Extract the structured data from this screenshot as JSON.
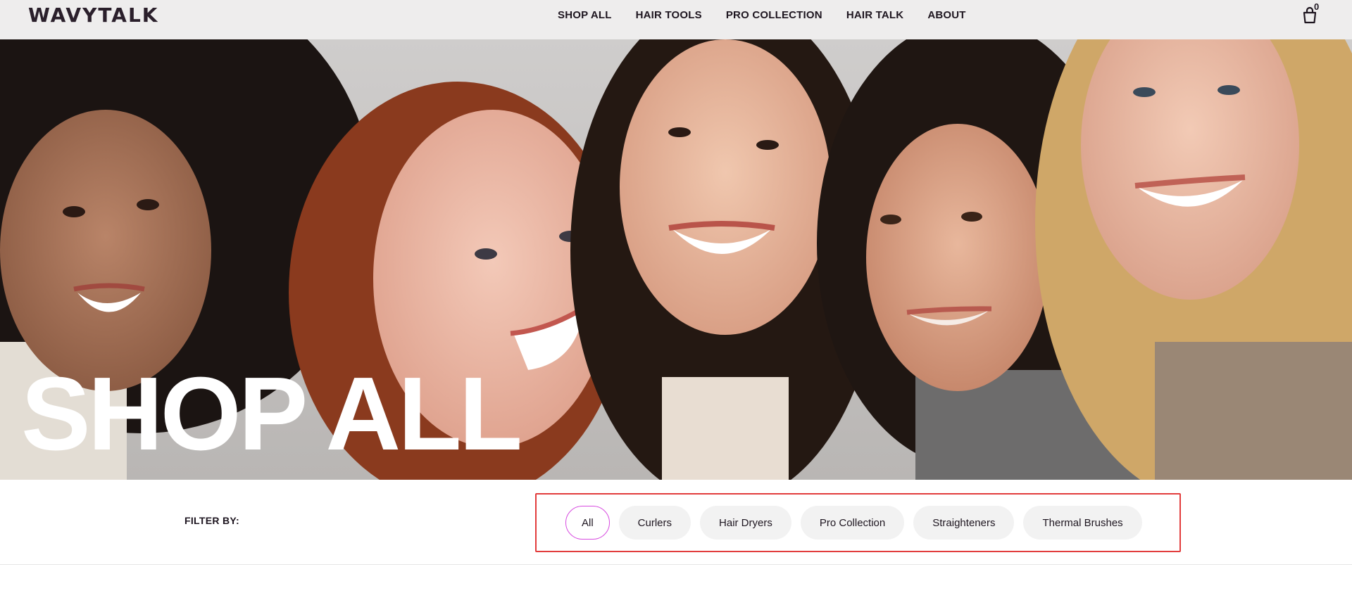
{
  "header": {
    "logo": "WAVYTALK",
    "nav": [
      "SHOP ALL",
      "HAIR TOOLS",
      "PRO COLLECTION",
      "HAIR TALK",
      "ABOUT"
    ],
    "cart_count": "0",
    "cart_icon": "shopping-bag-icon"
  },
  "hero": {
    "title": "SHOP ALL"
  },
  "filter": {
    "label": "FILTER BY:",
    "chips": [
      "All",
      "Curlers",
      "Hair Dryers",
      "Pro Collection",
      "Straighteners",
      "Thermal Brushes"
    ],
    "active": "All"
  },
  "colors": {
    "accent_outline": "#d74be0",
    "highlight_box": "#e23c3c",
    "header_bg": "#eeeded"
  }
}
